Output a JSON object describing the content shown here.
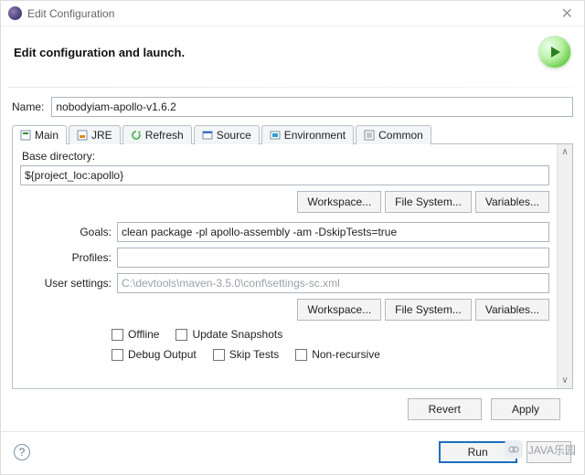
{
  "window": {
    "title": "Edit Configuration"
  },
  "banner": {
    "headline": "Edit configuration and launch."
  },
  "name": {
    "label": "Name:",
    "value": "nobodyiam-apollo-v1.6.2"
  },
  "tabs": {
    "items": [
      {
        "label": "Main"
      },
      {
        "label": "JRE"
      },
      {
        "label": "Refresh"
      },
      {
        "label": "Source"
      },
      {
        "label": "Environment"
      },
      {
        "label": "Common"
      }
    ]
  },
  "main_panel": {
    "base_dir_label": "Base directory:",
    "base_dir_value": "${project_loc:apollo}",
    "workspace_btn": "Workspace...",
    "file_system_btn": "File System...",
    "variables_btn": "Variables...",
    "goals_label": "Goals:",
    "goals_value": "clean package -pl apollo-assembly -am -DskipTests=true",
    "profiles_label": "Profiles:",
    "profiles_value": "",
    "user_settings_label": "User settings:",
    "user_settings_placeholder": "C:\\devtools\\maven-3.5.0\\conf\\settings-sc.xml",
    "checks": {
      "offline": "Offline",
      "update_snapshots": "Update Snapshots",
      "debug_output": "Debug Output",
      "skip_tests": "Skip Tests",
      "non_recursive": "Non-recursive"
    }
  },
  "footer": {
    "revert": "Revert",
    "apply": "Apply"
  },
  "bottom": {
    "run": "Run"
  },
  "watermark": "JAVA乐园"
}
